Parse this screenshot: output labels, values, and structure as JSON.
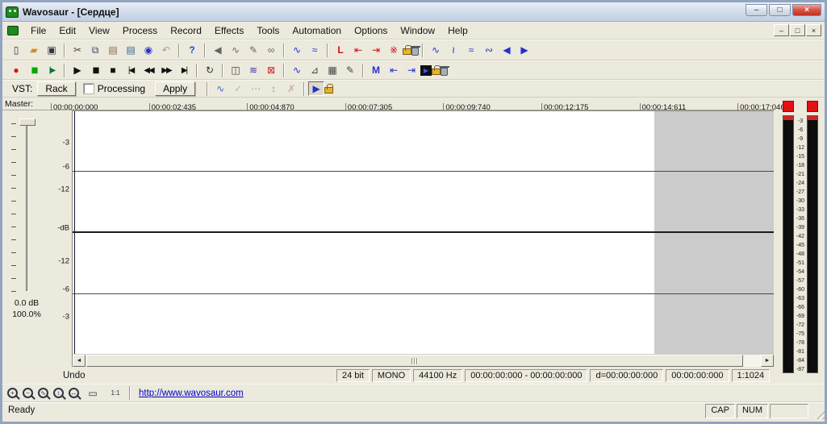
{
  "titlebar": {
    "title": "Wavosaur - [Сердце]",
    "buttons": [
      {
        "name": "minimize-button",
        "glyph": "–",
        "cls": "wbtn"
      },
      {
        "name": "maximize-button",
        "glyph": "□",
        "cls": "wbtn"
      },
      {
        "name": "close-button",
        "glyph": "×",
        "cls": "wbtn wclose"
      }
    ]
  },
  "menubar": {
    "items": [
      "File",
      "Edit",
      "View",
      "Process",
      "Record",
      "Effects",
      "Tools",
      "Automation",
      "Options",
      "Window",
      "Help"
    ],
    "mdi": [
      {
        "name": "mdi-minimize-button",
        "glyph": "–"
      },
      {
        "name": "mdi-restore-button",
        "glyph": "□"
      },
      {
        "name": "mdi-close-button",
        "glyph": "×"
      }
    ]
  },
  "toolbar1": {
    "items": [
      {
        "name": "new-file-icon",
        "glyph": "▯",
        "color": "#334"
      },
      {
        "name": "open-folder-icon",
        "glyph": "▰",
        "color": "#d09020"
      },
      {
        "name": "save-icon",
        "glyph": "▣",
        "color": "#334"
      },
      {
        "sep": true
      },
      {
        "name": "cut-icon",
        "glyph": "✂",
        "color": "#444"
      },
      {
        "name": "copy-icon",
        "glyph": "⧉",
        "color": "#446"
      },
      {
        "name": "paste-icon",
        "glyph": "▤",
        "color": "#865"
      },
      {
        "name": "paste-special-icon",
        "glyph": "▤",
        "color": "#368"
      },
      {
        "name": "paste-mix-icon",
        "glyph": "◉",
        "color": "#23c"
      },
      {
        "name": "undo-icon",
        "glyph": "↶",
        "dim": true
      },
      {
        "sep": true
      },
      {
        "name": "help-icon",
        "glyph": "?",
        "color": "#15c",
        "cls": "bold"
      },
      {
        "sep": true
      },
      {
        "name": "speaker-icon",
        "glyph": "◀",
        "color": "#666"
      },
      {
        "name": "interpolate-icon",
        "glyph": "∿",
        "color": "#666"
      },
      {
        "name": "pencil-icon",
        "glyph": "✎",
        "color": "#666"
      },
      {
        "name": "link-icon",
        "glyph": "∞",
        "color": "#666"
      },
      {
        "sep": true
      },
      {
        "name": "waveform-stats-icon",
        "glyph": "∿",
        "color": "#23c"
      },
      {
        "name": "waveform-view-icon",
        "glyph": "≈",
        "color": "#23c"
      },
      {
        "sep": true
      },
      {
        "name": "loop-points-icon",
        "glyph": "L",
        "color": "#c11",
        "cls": "bold"
      },
      {
        "name": "loop-start-icon",
        "glyph": "⇤",
        "color": "#c11"
      },
      {
        "name": "loop-end-icon",
        "glyph": "⇥",
        "color": "#c11"
      },
      {
        "name": "loop-clear-icon",
        "glyph": "※",
        "color": "#c11"
      },
      {
        "name": "loop-lock-icon",
        "cls": "icon-lock"
      },
      {
        "name": "loop-delete-icon",
        "cls": "icon-trash"
      },
      {
        "sep": true
      },
      {
        "name": "select-all-icon",
        "glyph": "∿",
        "color": "#23c"
      },
      {
        "name": "selection-start-icon",
        "glyph": "≀",
        "color": "#23c"
      },
      {
        "name": "selection-end-icon",
        "glyph": "≈",
        "color": "#23c"
      },
      {
        "name": "selection-extend-icon",
        "glyph": "∾",
        "color": "#23c"
      },
      {
        "name": "previous-region-icon",
        "glyph": "◀",
        "color": "#23c"
      },
      {
        "name": "next-region-icon",
        "glyph": "▶",
        "color": "#23c"
      }
    ]
  },
  "toolbar2": {
    "items": [
      {
        "name": "record-icon",
        "glyph": "●",
        "color": "#d11"
      },
      {
        "name": "record-pause-icon",
        "glyph": "▮▮",
        "color": "#0a0",
        "cls": "narrow"
      },
      {
        "name": "play-from-cursor-icon",
        "glyph": "|▶",
        "color": "#073",
        "cls": "narrow"
      },
      {
        "sep": true
      },
      {
        "name": "play-icon",
        "glyph": "▶",
        "color": "#111"
      },
      {
        "name": "pause-icon",
        "glyph": "▮▮",
        "color": "#111",
        "cls": "narrow"
      },
      {
        "name": "stop-icon",
        "glyph": "■",
        "color": "#111"
      },
      {
        "name": "go-to-start-icon",
        "glyph": "|◀",
        "color": "#111",
        "cls": "narrow"
      },
      {
        "name": "rewind-icon",
        "glyph": "◀◀",
        "color": "#111",
        "cls": "narrow"
      },
      {
        "name": "fast-forward-icon",
        "glyph": "▶▶",
        "color": "#111",
        "cls": "narrow"
      },
      {
        "name": "go-to-end-icon",
        "glyph": "▶|",
        "color": "#111",
        "cls": "narrow"
      },
      {
        "sep": true
      },
      {
        "name": "loop-playback-icon",
        "glyph": "↻",
        "color": "#333"
      },
      {
        "sep": true
      },
      {
        "name": "waveform-doc-icon",
        "glyph": "◫",
        "color": "#444"
      },
      {
        "name": "sonogram-icon",
        "glyph": "≋",
        "color": "#339"
      },
      {
        "name": "delete-red-icon",
        "glyph": "⊠",
        "color": "#c22"
      },
      {
        "sep": true
      },
      {
        "name": "selection-tool-icon",
        "glyph": "∿",
        "color": "#23c"
      },
      {
        "name": "zero-crossing-icon",
        "glyph": "⊿",
        "color": "#444"
      },
      {
        "name": "grid-snap-icon",
        "glyph": "▦",
        "color": "#444"
      },
      {
        "name": "draw-tool-icon",
        "glyph": "✎",
        "color": "#444"
      },
      {
        "sep": true
      },
      {
        "name": "add-marker-icon",
        "glyph": "M",
        "color": "#23c",
        "cls": "bold"
      },
      {
        "name": "previous-marker-icon",
        "glyph": "⇤",
        "color": "#23c"
      },
      {
        "name": "next-marker-icon",
        "glyph": "⇥",
        "color": "#23c"
      },
      {
        "name": "play-marker-icon",
        "glyph": "▶",
        "cls": "icon-boxed"
      },
      {
        "name": "marker-lock-icon",
        "cls": "icon-lock"
      },
      {
        "name": "marker-delete-icon",
        "cls": "icon-trash"
      }
    ]
  },
  "vst": {
    "label": "VST:",
    "rack_label": "Rack",
    "processing_label": "Processing",
    "apply_label": "Apply",
    "icons": [
      {
        "name": "vst-chain-icon",
        "glyph": "∿",
        "color": "#46c"
      },
      {
        "name": "vst-apply-check-icon",
        "glyph": "✓",
        "color": "#083",
        "dim": true
      },
      {
        "name": "vst-more-icon",
        "glyph": "⋯",
        "dim": true
      },
      {
        "name": "vst-reorder-icon",
        "glyph": "↕",
        "dim": true
      },
      {
        "name": "vst-remove-icon",
        "glyph": "✗",
        "color": "#c33",
        "dim": true
      },
      {
        "sep": true
      },
      {
        "name": "vst-bypass-play-icon",
        "glyph": "▶",
        "color": "#23c",
        "cls": "btn-pressed"
      },
      {
        "name": "vst-lock-icon",
        "cls": "icon-lock"
      }
    ]
  },
  "ruler": {
    "labels": [
      "00:00:00:000",
      "00:00:02:435",
      "00:00:04:870",
      "00:00:07:305",
      "00:00:09:740",
      "00:00:12:175",
      "00:00:14:611",
      "00:00:17:046"
    ]
  },
  "master": {
    "label": "Master:",
    "gain_db": "0.0 dB",
    "gain_percent": "100.0%"
  },
  "wave": {
    "db_labels": [
      {
        "name": "db-label-top-3",
        "label": "-3",
        "inter": false
      },
      {
        "name": "db-label-top-6",
        "label": "-6",
        "inter": false
      },
      {
        "name": "db-label-top-12",
        "label": "-12",
        "inter": false
      },
      {
        "name": "db-label-center",
        "label": "-dB",
        "inter": false
      },
      {
        "name": "db-label-bottom-12",
        "label": "-12",
        "inter": false
      },
      {
        "name": "db-label-bottom-6",
        "label": "-6",
        "inter": false
      },
      {
        "name": "db-label-bottom-3",
        "label": "-3",
        "inter": false
      }
    ]
  },
  "meters": {
    "scale": [
      "-3",
      "-6",
      "-9",
      "-12",
      "-15",
      "-18",
      "-21",
      "-24",
      "-27",
      "-30",
      "-33",
      "-36",
      "-39",
      "-42",
      "-45",
      "-48",
      "-51",
      "-54",
      "-57",
      "-60",
      "-63",
      "-66",
      "-69",
      "-72",
      "-75",
      "-78",
      "-81",
      "-84",
      "-87"
    ]
  },
  "status1": {
    "undo_label": "Undo",
    "fields": [
      {
        "name": "bit-depth-field",
        "label": "24 bit",
        "inter": false
      },
      {
        "name": "channel-mode-field",
        "label": "MONO",
        "inter": false
      },
      {
        "name": "sample-rate-field",
        "label": "44100 Hz",
        "inter": false
      },
      {
        "name": "selection-range-field",
        "label": "00:00:00:000 - 00:00:00:000",
        "inter": false
      },
      {
        "name": "selection-duration-field",
        "label": "d=00:00:00:000",
        "inter": false
      },
      {
        "name": "cursor-position-field",
        "label": "00:00:00:000",
        "inter": false
      },
      {
        "name": "zoom-ratio-field",
        "label": "1:1024",
        "inter": false
      }
    ]
  },
  "bottom": {
    "icons": [
      {
        "name": "zoom-in-icon",
        "glyph": "+",
        "cls": "icon-zoom"
      },
      {
        "name": "zoom-out-icon",
        "glyph": "−",
        "cls": "icon-zoom"
      },
      {
        "name": "zoom-selection-icon",
        "glyph": "∿",
        "cls": "icon-zoom"
      },
      {
        "name": "zoom-vertical-in-icon",
        "glyph": "↕",
        "cls": "icon-zoom"
      },
      {
        "name": "zoom-vertical-out-icon",
        "glyph": "↔",
        "cls": "icon-zoom"
      },
      {
        "name": "zoom-full-icon",
        "glyph": "▭",
        "color": "#334"
      },
      {
        "name": "zoom-one-to-one-icon",
        "glyph": "1:1",
        "color": "#334",
        "cls": "tiny"
      }
    ],
    "link_text": "http://www.wavosaur.com"
  },
  "status2": {
    "ready_label": "Ready",
    "indicators": [
      {
        "name": "caps-indicator",
        "label": "CAP",
        "inter": false
      },
      {
        "name": "num-indicator",
        "label": "NUM",
        "inter": false
      },
      {
        "name": "scroll-indicator",
        "label": "",
        "inter": false
      }
    ]
  },
  "colors": {
    "clip_indicator_red": "#e31111",
    "link_blue": "#0000cc",
    "icon_blue": "#2233cc",
    "icon_red": "#cc1111",
    "wave_background": "#ffffff",
    "wave_tail_gray": "#cbcbcb"
  }
}
